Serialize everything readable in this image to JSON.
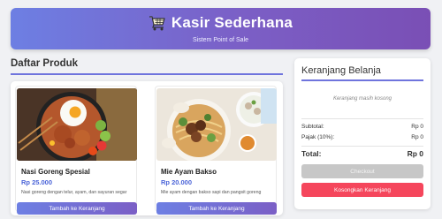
{
  "header": {
    "icon": "shopping-cart-icon",
    "title": "Kasir Sederhana",
    "subtitle": "Sistem Point of Sale",
    "gradient": [
      "#6d7fe3",
      "#7a4fb5"
    ]
  },
  "products": {
    "heading": "Daftar Produk",
    "items": [
      {
        "name": "Nasi Goreng Spesial",
        "price": "Rp 25.000",
        "description": "Nasi goreng dengan telur, ayam, dan sayuran segar",
        "button_label": "Tambah ke Keranjang",
        "image": "fried-rice-photo"
      },
      {
        "name": "Mie Ayam Bakso",
        "price": "Rp 20.000",
        "description": "Mie ayam dengan bakso sapi dan pangsit goreng",
        "button_label": "Tambah ke Keranjang",
        "image": "chicken-noodle-meatball-photo"
      }
    ]
  },
  "cart": {
    "heading": "Keranjang Belanja",
    "empty_text": "Keranjang masih kosong",
    "subtotal_label": "Subtotal:",
    "subtotal_value": "Rp 0",
    "tax_label": "Pajak (10%):",
    "tax_value": "Rp 0",
    "total_label": "Total:",
    "total_value": "Rp 0",
    "checkout_label": "Checkout",
    "clear_label": "Kosongkan Keranjang"
  },
  "colors": {
    "accent": "#6d7fe3",
    "price": "#4a63d8",
    "danger": "#f5465c",
    "disabled": "#c7c7c7"
  }
}
